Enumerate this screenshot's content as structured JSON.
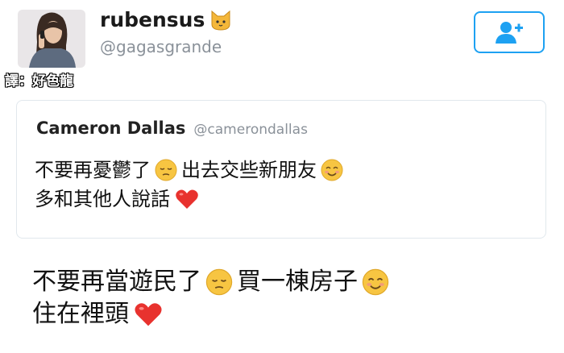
{
  "user": {
    "display_name": "rubensus",
    "handle": "@gagasgrande",
    "name_emoji_icon": "cat-face-icon",
    "avatar_icon": "profile-photo"
  },
  "watermark": "譯：好色龍",
  "follow_button": {
    "icon": "add-user-icon",
    "color": "#1da1f2"
  },
  "quoted_tweet": {
    "name": "Cameron Dallas",
    "handle": "@camerondallas",
    "line1_a": "不要再憂鬱了",
    "line1_b": "出去交些新朋友",
    "line2": "多和其他人說話"
  },
  "tweet": {
    "line1_a": "不要再當遊民了",
    "line1_b": "買一棟房子",
    "line2": "住在裡頭"
  },
  "emoji_icons": [
    "pensive-face-icon",
    "smiling-face-icon",
    "red-heart-icon"
  ]
}
